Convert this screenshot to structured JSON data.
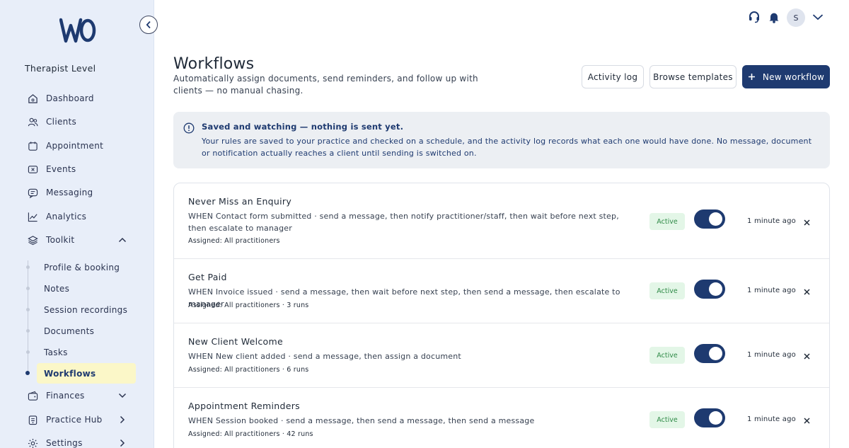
{
  "sidebar": {
    "logo_alt": "wo",
    "level": "Therapist Level",
    "items": [
      {
        "label": "Dashboard",
        "icon": "home-icon"
      },
      {
        "label": "Clients",
        "icon": "users-icon"
      },
      {
        "label": "Appointment",
        "icon": "calendar-icon"
      },
      {
        "label": "Events",
        "icon": "ticket-icon"
      },
      {
        "label": "Messaging",
        "icon": "chat-icon"
      },
      {
        "label": "Analytics",
        "icon": "chart-icon"
      },
      {
        "label": "Toolkit",
        "icon": "layers-icon"
      }
    ],
    "toolkit_sub": [
      "Profile & booking",
      "Notes",
      "Session recordings",
      "Documents",
      "Tasks",
      "Workflows"
    ],
    "bottom_items": [
      {
        "label": "Finances",
        "icon": "wallet-icon"
      },
      {
        "label": "Practice Hub",
        "icon": "hub-icon"
      },
      {
        "label": "Settings",
        "icon": "gear-icon"
      }
    ]
  },
  "topbar": {
    "avatar_initial": "S"
  },
  "header": {
    "title": "Workflows",
    "subtitle": "Automatically assign documents, send reminders, and follow up with clients — no manual chasing.",
    "activity_log": "Activity log",
    "browse_templates": "Browse templates",
    "new_workflow": "New workflow"
  },
  "notice": {
    "title": "Saved and watching — nothing is sent yet.",
    "body": "Your rules are saved to your practice and checked on a schedule, and the activity log records what each one would have done. No message, document or notification actually reaches a client until sending is switched on."
  },
  "workflows": [
    {
      "name": "Never Miss an Enquiry",
      "when": "WHEN Contact form submitted · send a message, then notify practitioner/staff, then wait before next step, then escalate to manager",
      "assigned": "Assigned: All practitioners",
      "status": "Active",
      "enabled": true,
      "updated": "1 minute ago"
    },
    {
      "name": "Get Paid",
      "when": "WHEN Invoice issued · send a message, then wait before next step, then send a message, then escalate to manager",
      "assigned": "Assigned: All practitioners · 3 runs",
      "status": "Active",
      "enabled": true,
      "updated": "1 minute ago"
    },
    {
      "name": "New Client Welcome",
      "when": "WHEN New client added · send a message, then assign a document",
      "assigned": "Assigned: All practitioners · 6 runs",
      "status": "Active",
      "enabled": true,
      "updated": "1 minute ago"
    },
    {
      "name": "Appointment Reminders",
      "when": "WHEN Session booked · send a message, then send a message, then send a message",
      "assigned": "Assigned: All practitioners · 42 runs",
      "status": "Active",
      "enabled": true,
      "updated": "1 minute ago"
    }
  ],
  "colors": {
    "sidebar_bg": "#e8eef9",
    "primary": "#1e3a70",
    "active_badge_bg": "#e3f6e7",
    "active_badge_text": "#2f8a47",
    "active_nav_bg": "#fbf7c8"
  }
}
